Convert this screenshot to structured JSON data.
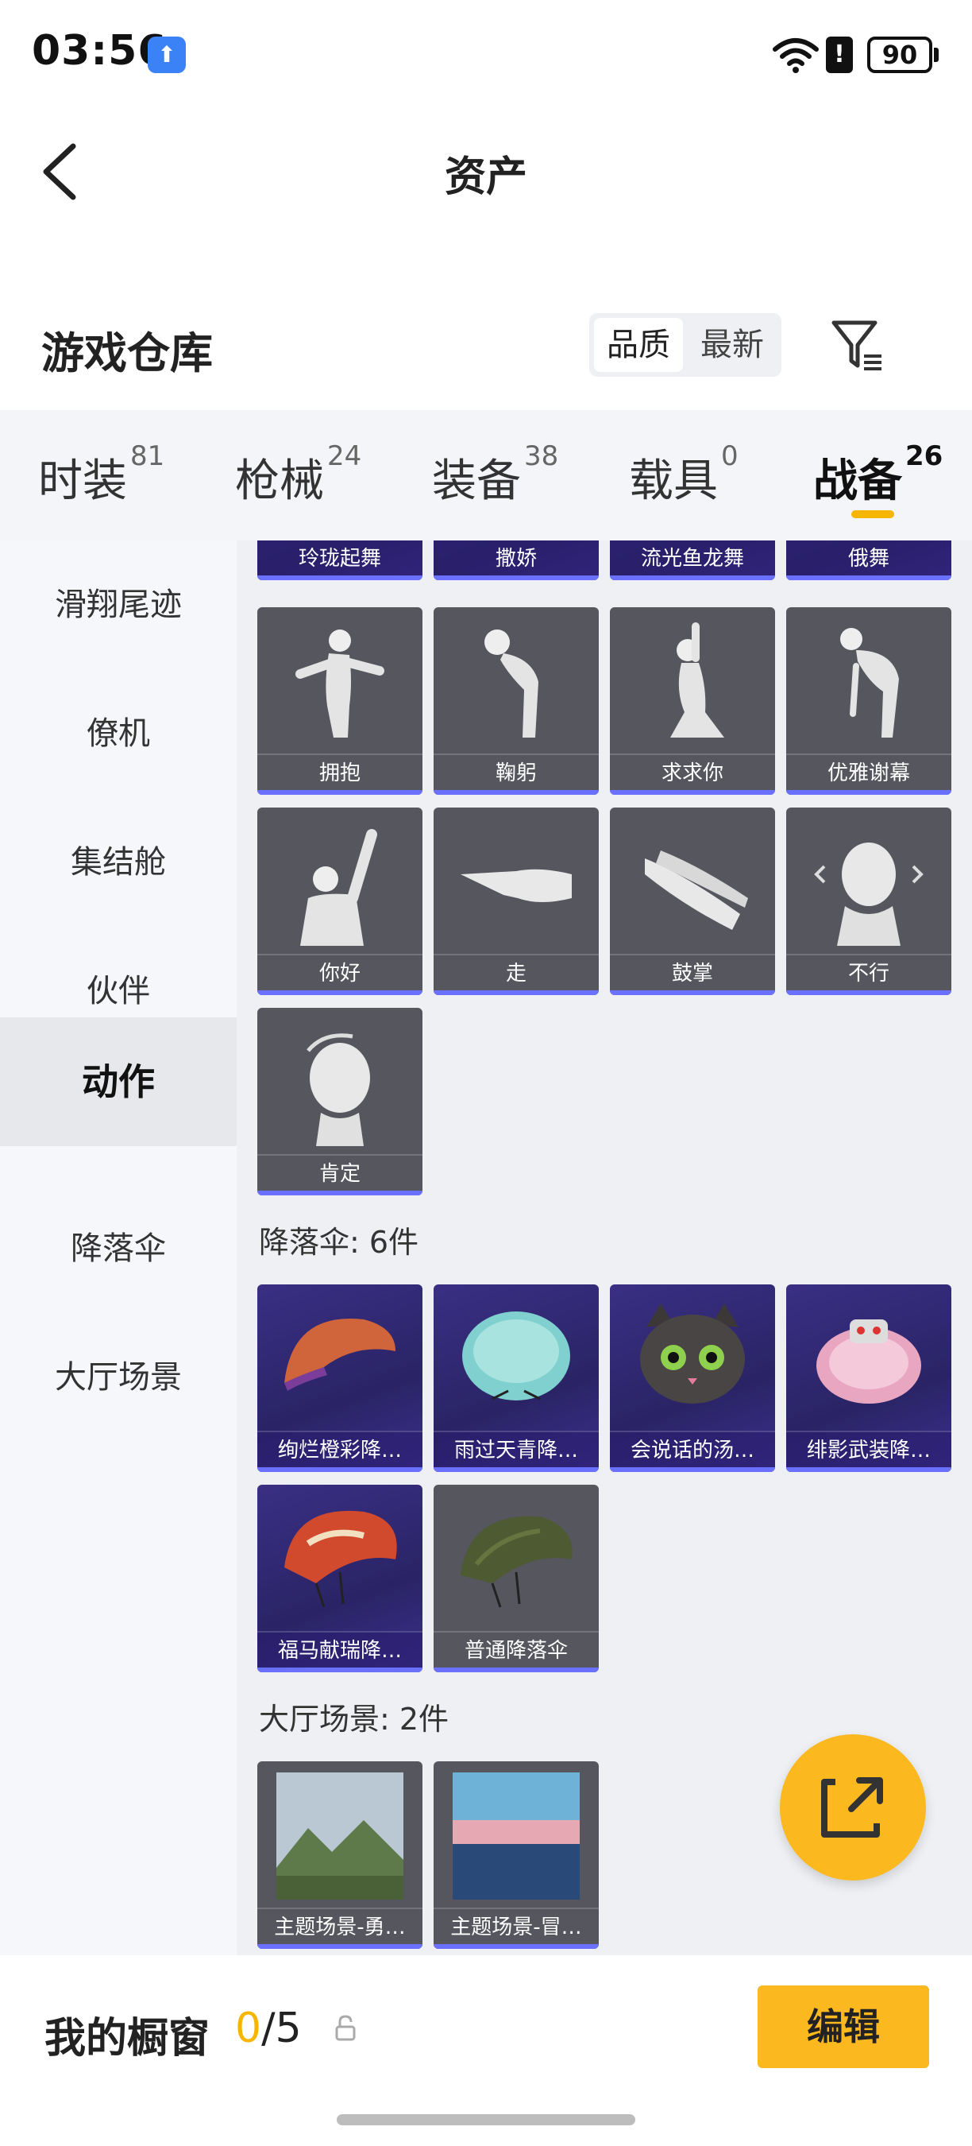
{
  "status_bar": {
    "time": "03:56",
    "battery": "90",
    "notif_icon": "upload-icon"
  },
  "header": {
    "title": "资产"
  },
  "warehouse": {
    "title": "游戏仓库",
    "sort_options": [
      "品质",
      "最新"
    ],
    "selected_sort": "品质"
  },
  "tabs": [
    {
      "label": "时装",
      "count": "81"
    },
    {
      "label": "枪械",
      "count": "24"
    },
    {
      "label": "装备",
      "count": "38"
    },
    {
      "label": "载具",
      "count": "0"
    },
    {
      "label": "战备",
      "count": "26"
    }
  ],
  "active_tab": "战备",
  "sidebar": {
    "items": [
      "滑翔尾迹",
      "僚机",
      "集结舱",
      "伙伴",
      "动作",
      "降落伞",
      "大厅场景"
    ],
    "active": "动作"
  },
  "actions": {
    "partial_row": [
      "玲珑起舞",
      "撒娇",
      "流光鱼龙舞",
      "俄舞"
    ],
    "items": [
      "拥抱",
      "鞠躬",
      "求求你",
      "优雅谢幕",
      "你好",
      "走",
      "鼓掌",
      "不行",
      "肯定"
    ]
  },
  "parachutes": {
    "title": "降落伞: 6件",
    "items": [
      "绚烂橙彩降…",
      "雨过天青降…",
      "会说话的汤…",
      "绯影武装降…",
      "福马献瑞降…",
      "普通降落伞"
    ]
  },
  "lobby": {
    "title": "大厅场景: 2件",
    "items": [
      "主题场景-勇…",
      "主题场景-冒…"
    ]
  },
  "bottom": {
    "label": "我的橱窗",
    "current": "0",
    "total": "/5",
    "edit": "编辑"
  },
  "colors": {
    "accent": "#fbb81f",
    "rare_bar": "#6a70ff",
    "card_grey": "#55565e",
    "card_purple": "#2f276e"
  }
}
